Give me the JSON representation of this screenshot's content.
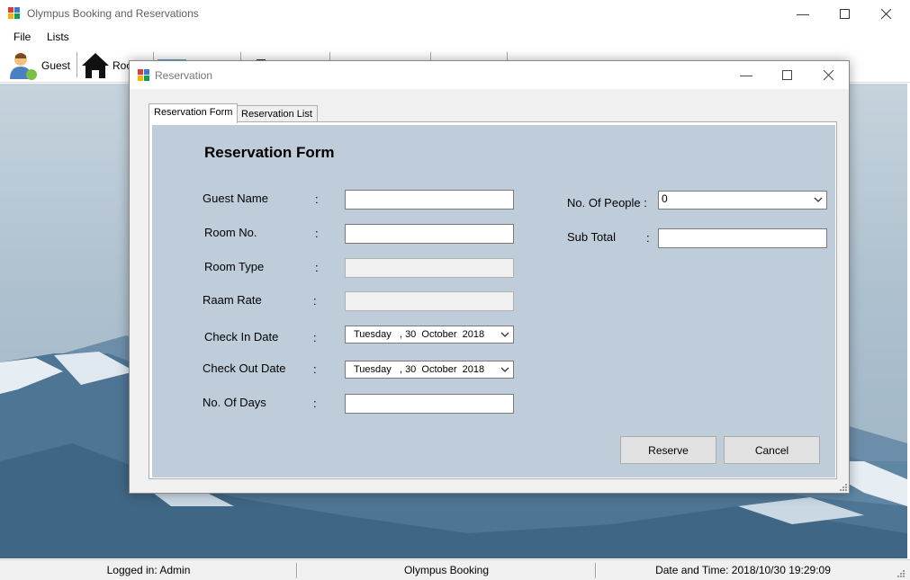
{
  "main_window": {
    "title": "Olympus Booking and Reservations",
    "menu": [
      "File",
      "Lists"
    ],
    "toolbar": {
      "guest_label": "Guest",
      "rooms_label": "Roo"
    }
  },
  "dialog": {
    "title": "Reservation",
    "tabs": [
      "Reservation Form",
      "Reservation List"
    ],
    "heading": "Reservation Form",
    "fields": {
      "guest_name_label": "Guest Name",
      "room_no_label": "Room No.",
      "room_type_label": "Room Type",
      "room_rate_label": "Raam Rate",
      "check_in_label": "Check In Date",
      "check_out_label": "Check Out Date",
      "no_of_days_label": "No. Of Days",
      "no_of_people_label": "No. Of People :",
      "sub_total_label": "Sub Total",
      "colon": ":"
    },
    "values": {
      "check_in_date": "Tuesday   , 30  October  2018",
      "check_out_date": "Tuesday   , 30  October  2018",
      "no_of_people": "0"
    },
    "buttons": {
      "reserve": "Reserve",
      "cancel": "Cancel"
    }
  },
  "status_bar": {
    "logged_in": "Logged in: Admin",
    "app_name": "Olympus Booking",
    "date_time": "Date and Time: 2018/10/30 19:29:09"
  },
  "colors": {
    "form_background": "#bfcddb",
    "desktop_background": "#adc0ce"
  }
}
